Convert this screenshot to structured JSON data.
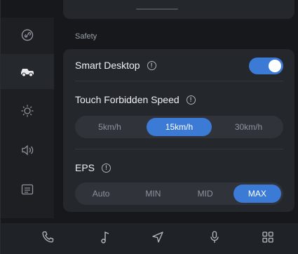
{
  "section": {
    "title": "Safety"
  },
  "smart_desktop": {
    "label": "Smart Desktop",
    "enabled": true
  },
  "touch_forbidden_speed": {
    "label": "Touch Forbidden Speed",
    "options": [
      "5km/h",
      "15km/h",
      "30km/h"
    ],
    "selected": "15km/h"
  },
  "eps": {
    "label": "EPS",
    "options": [
      "Auto",
      "MIN",
      "MID",
      "MAX"
    ],
    "selected": "MAX"
  },
  "sidebar": {
    "items": [
      {
        "icon": "link-icon",
        "active": false
      },
      {
        "icon": "vehicle-icon",
        "active": true
      },
      {
        "icon": "brightness-icon",
        "active": false
      },
      {
        "icon": "volume-icon",
        "active": false
      },
      {
        "icon": "display-icon",
        "active": false
      }
    ]
  },
  "bottom_nav": {
    "items": [
      "phone-icon",
      "music-icon",
      "navigation-icon",
      "microphone-icon",
      "apps-icon"
    ]
  },
  "colors": {
    "accent": "#3b7bd6",
    "card": "#24272c",
    "background": "#16181c"
  }
}
